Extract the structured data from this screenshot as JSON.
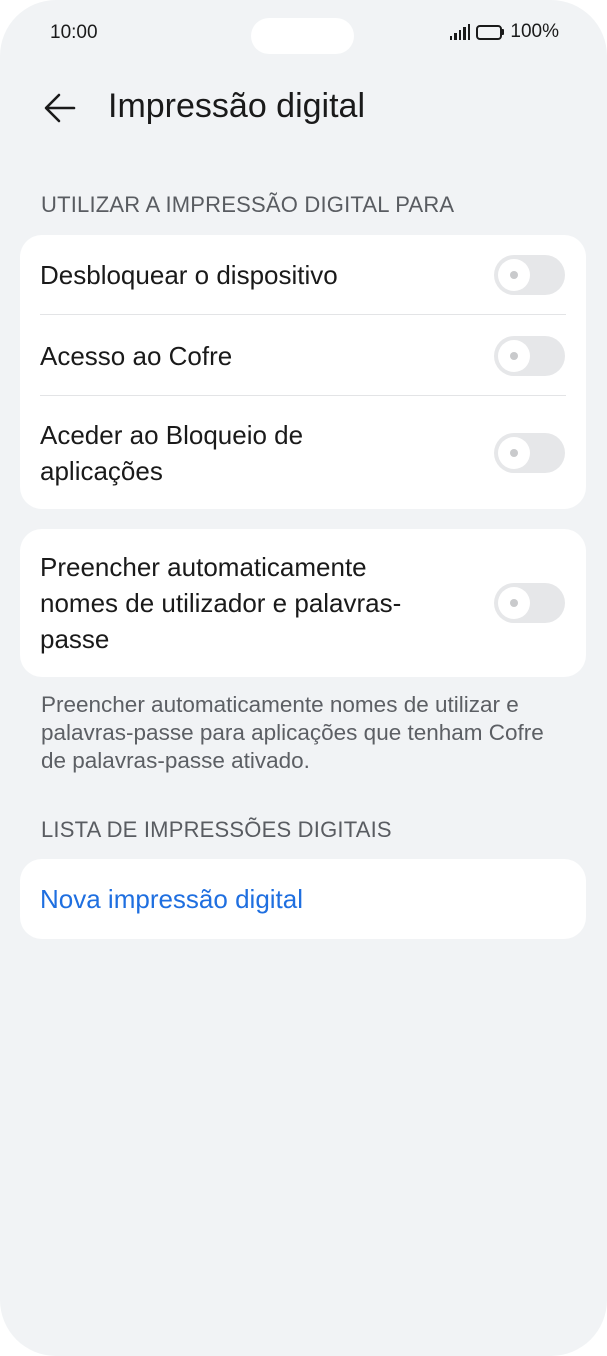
{
  "status_bar": {
    "time": "10:00",
    "battery": "100%",
    "icons": [
      "signal-icon",
      "battery-icon"
    ]
  },
  "header": {
    "title": "Impressão digital",
    "back_icon": "arrow-left-icon"
  },
  "sections": {
    "use_for": {
      "label": "UTILIZAR A IMPRESSÃO DIGITAL PARA",
      "items": [
        {
          "label": "Desbloquear o dispositivo",
          "enabled": false
        },
        {
          "label": "Acesso ao Cofre",
          "enabled": false
        },
        {
          "label": "Aceder ao Bloqueio de aplicações",
          "enabled": false
        }
      ]
    },
    "autofill": {
      "label": "Preencher automaticamente nomes de utilizador e palavras-passe",
      "enabled": false,
      "footnote": "Preencher automaticamente nomes de utilizar e palavras-passe para aplicações que tenham Cofre de palavras-passe ativado."
    },
    "fingerprint_list": {
      "label": "LISTA DE IMPRESSÕES DIGITAIS",
      "new_label": "Nova impressão digital"
    }
  },
  "colors": {
    "background": "#f1f3f5",
    "card": "#ffffff",
    "link": "#1f6fe0",
    "toggle_off": "#e6e7e9"
  }
}
